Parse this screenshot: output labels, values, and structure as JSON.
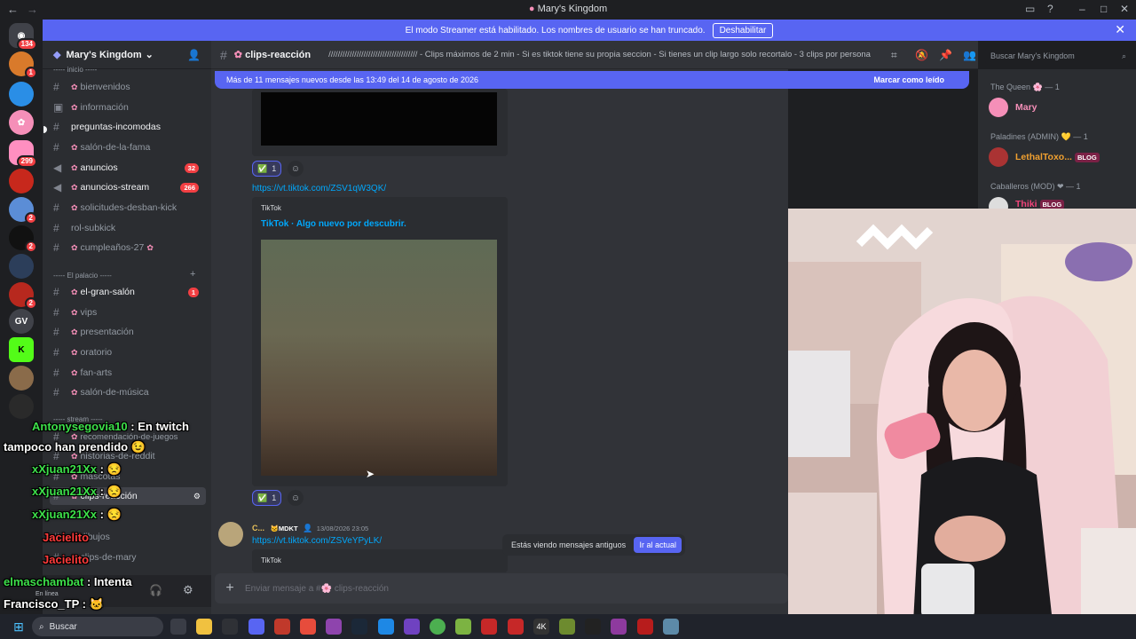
{
  "window": {
    "title": "Mary's Kingdom"
  },
  "banner": {
    "text": "El modo Streamer está habilitado. Los nombres de usuario se han truncado.",
    "button": "Deshabilitar"
  },
  "server": {
    "name": "Mary's Kingdom"
  },
  "rail_badges": {
    "discord_home": "134",
    "s5": "299",
    "gv": "GV"
  },
  "sidebar": {
    "cat_inicio": "----- inicio -----",
    "cat_palacio": "----- El palacio -----",
    "cat_stream": "----- stream -----",
    "channels": [
      {
        "name": "bienvenidos"
      },
      {
        "name": "información"
      },
      {
        "name": "preguntas-incomodas"
      },
      {
        "name": "salón-de-la-fama"
      },
      {
        "name": "anuncios",
        "badge": "32"
      },
      {
        "name": "anuncios-stream",
        "badge": "266"
      },
      {
        "name": "solicitudes-desban-kick"
      },
      {
        "name": "rol-subkick"
      },
      {
        "name": "cumpleaños-27"
      },
      {
        "name": "el-gran-salón",
        "badge": "1"
      },
      {
        "name": "vips"
      },
      {
        "name": "presentación"
      },
      {
        "name": "oratorio"
      },
      {
        "name": "fan-arts"
      },
      {
        "name": "salón-de-música"
      },
      {
        "name": "recomendación-de-juegos"
      },
      {
        "name": "historias-de-reddit"
      },
      {
        "name": "mascotas"
      },
      {
        "name": "clips-reacción"
      },
      {
        "name": "dibujos"
      },
      {
        "name": "clips-de-mary"
      }
    ],
    "user_status": "En línea"
  },
  "channel": {
    "name": "clips-reacción",
    "topic": "////////////////////////////////////// - Clips máximos de 2 min - Si es tiktok tiene su propia seccion - Si tienes un clip largo solo recortalo - 3 clips por persona"
  },
  "search": {
    "placeholder": "Buscar Mary's Kingdom"
  },
  "new_messages": {
    "text": "Más de 11 mensajes nuevos desde las 13:49 del 14 de agosto de 2026",
    "action": "Marcar como leído"
  },
  "messages": {
    "reaction1_count": "1",
    "link1": "https://vt.tiktok.com/ZSV1qW3QK/",
    "embed_provider": "TikTok",
    "embed_title": "TikTok · Algo nuevo por descubrir.",
    "reaction2_count": "1",
    "msg2_author": "C...",
    "msg2_tag": "MDKT",
    "msg2_time": "13/08/2026 23:05",
    "link2": "https://vt.tiktok.com/ZSVeYPyLK/",
    "embed2_provider": "TikTok"
  },
  "old_messages": {
    "text": "Estás viendo mensajes antiguos",
    "button": "Ir al actual"
  },
  "composer": {
    "placeholder": "Enviar mensaje a #🌸 clips-reacción"
  },
  "members": {
    "role1": "The Queen 🌸 — 1",
    "member1": "Mary",
    "role2": "Paladines (ADMIN) 💛 — 1",
    "member2": "LethalToxo...",
    "tag2": "BLOG",
    "role3": "Caballeros (MOD) ❤ — 1",
    "member3": "Thiki",
    "tag3": "BLOG",
    "colors": {
      "mary": "#f58fb8",
      "lethal": "#f0a030",
      "thiki": "#f0447a"
    }
  },
  "stream_chat": [
    {
      "user": "Antonysegovia10",
      "msg": ": En twitch"
    },
    {
      "user": "",
      "msg": "tampoco han prendido"
    },
    {
      "user": "xXjuan21Xx",
      "msg": ":"
    },
    {
      "user": "xXjuan21Xx",
      "msg": ":"
    },
    {
      "user": "xXjuan21Xx",
      "msg": ":"
    },
    {
      "user": "Jacielito",
      "msg": ""
    },
    {
      "user": "Jacielito",
      "msg": ""
    },
    {
      "user": "elmaschambat",
      "msg": ": Intenta"
    },
    {
      "user": "Francisco_TP",
      "msg": ":"
    }
  ],
  "taskbar": {
    "search": "Buscar"
  }
}
